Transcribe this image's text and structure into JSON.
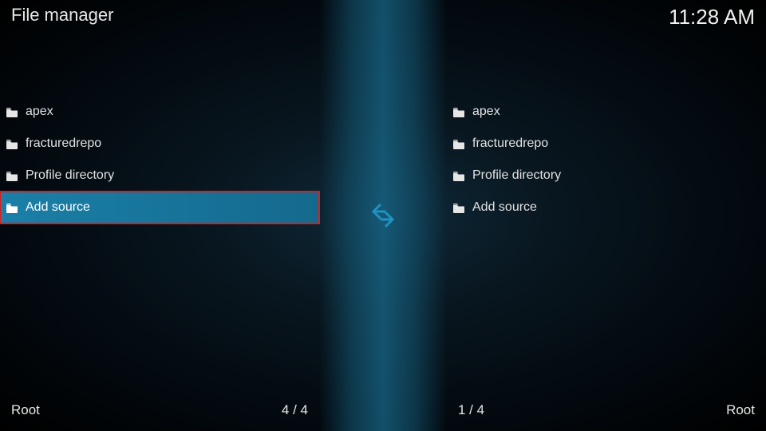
{
  "header": {
    "title": "File manager",
    "clock": "11:28 AM"
  },
  "panes": {
    "left": {
      "items": [
        {
          "label": "apex",
          "icon": "folder"
        },
        {
          "label": "fracturedrepo",
          "icon": "folder"
        },
        {
          "label": "Profile directory",
          "icon": "folder"
        },
        {
          "label": "Add source",
          "icon": "folder",
          "selected": true,
          "highlighted": true
        }
      ],
      "footer_label": "Root",
      "footer_count": "4 / 4"
    },
    "right": {
      "items": [
        {
          "label": "apex",
          "icon": "folder"
        },
        {
          "label": "fracturedrepo",
          "icon": "folder"
        },
        {
          "label": "Profile directory",
          "icon": "folder"
        },
        {
          "label": "Add source",
          "icon": "folder"
        }
      ],
      "footer_label": "Root",
      "footer_count": "1 / 4"
    }
  }
}
